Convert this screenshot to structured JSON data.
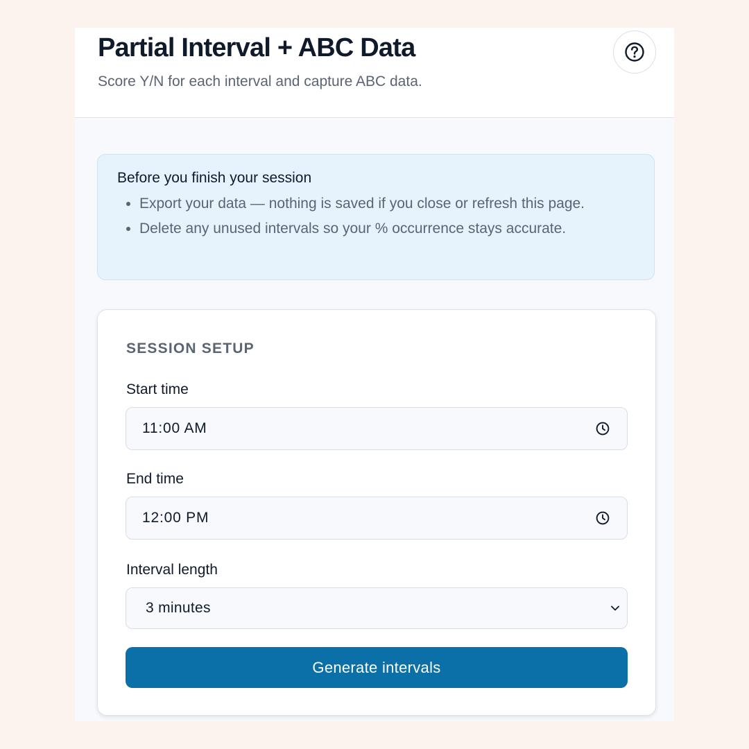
{
  "header": {
    "title": "Partial Interval + ABC Data",
    "subtitle": "Score Y/N for each interval and capture ABC data.",
    "help_icon": "question-circle-icon"
  },
  "notice": {
    "title": "Before you finish your session",
    "items": [
      "Export your data — nothing is saved if you close or refresh this page.",
      "Delete any unused intervals so your % occurrence stays accurate."
    ]
  },
  "session_setup": {
    "heading": "SESSION SETUP",
    "start_time": {
      "label": "Start time",
      "value": "11:00 AM",
      "icon": "clock-icon"
    },
    "end_time": {
      "label": "End time",
      "value": "12:00 PM",
      "icon": "clock-icon"
    },
    "interval_length": {
      "label": "Interval length",
      "value": "3 minutes",
      "icon": "chevron-down-icon"
    },
    "generate_label": "Generate intervals"
  },
  "colors": {
    "page_background": "#fdf3ee",
    "panel_background": "#f7f9fc",
    "notice_background": "#e6f3fc",
    "primary_button": "#0b6fa8",
    "text_dark": "#0f1a2a",
    "text_muted": "#5a6472"
  }
}
